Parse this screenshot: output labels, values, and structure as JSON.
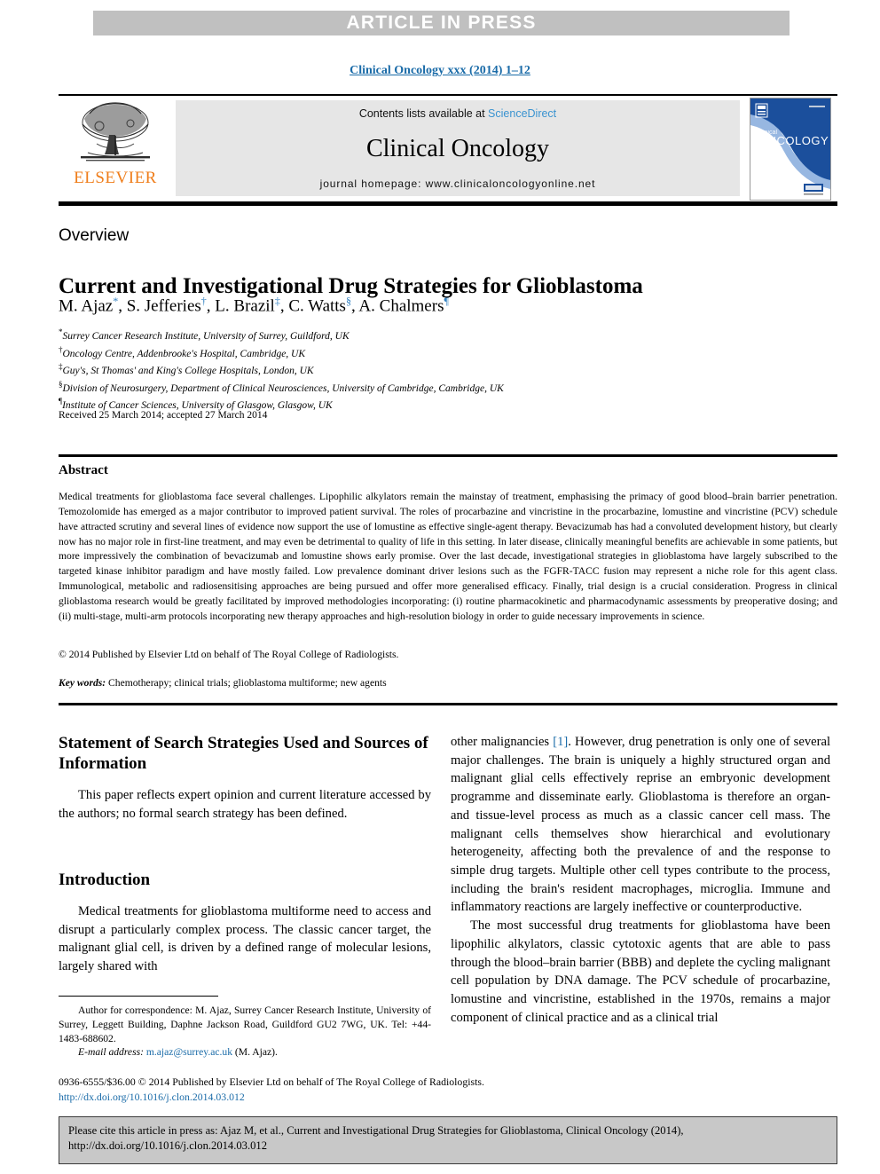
{
  "banner": {
    "text": "ARTICLE IN PRESS"
  },
  "journal_ref": "Clinical Oncology xxx (2014) 1–12",
  "masthead": {
    "publisher_wordmark": "ELSEVIER",
    "contents_prefix": "Contents lists available at ",
    "contents_link": "ScienceDirect",
    "journal_title": "Clinical Oncology",
    "homepage": "journal homepage: www.clinicaloncologyonline.net",
    "cover_line1": "clinical",
    "cover_line2": "ONCOLOGY"
  },
  "article": {
    "type_label": "Overview",
    "title": "Current and Investigational Drug Strategies for Glioblastoma",
    "authors": [
      {
        "name": "M. Ajaz",
        "marker": "*"
      },
      {
        "name": "S. Jefferies",
        "marker": "†"
      },
      {
        "name": "L. Brazil",
        "marker": "‡"
      },
      {
        "name": "C. Watts",
        "marker": "§"
      },
      {
        "name": "A. Chalmers",
        "marker": "¶"
      }
    ],
    "affiliations": [
      {
        "marker": "*",
        "text": "Surrey Cancer Research Institute, University of Surrey, Guildford, UK"
      },
      {
        "marker": "†",
        "text": "Oncology Centre, Addenbrooke's Hospital, Cambridge, UK"
      },
      {
        "marker": "‡",
        "text": "Guy's, St Thomas' and King's College Hospitals, London, UK"
      },
      {
        "marker": "§",
        "text": "Division of Neurosurgery, Department of Clinical Neurosciences, University of Cambridge, Cambridge, UK"
      },
      {
        "marker": "¶",
        "text": "Institute of Cancer Sciences, University of Glasgow, Glasgow, UK"
      }
    ],
    "history": "Received 25 March 2014; accepted 27 March 2014"
  },
  "abstract": {
    "heading": "Abstract",
    "body": "Medical treatments for glioblastoma face several challenges. Lipophilic alkylators remain the mainstay of treatment, emphasising the primacy of good blood–brain barrier penetration. Temozolomide has emerged as a major contributor to improved patient survival. The roles of procarbazine and vincristine in the procarbazine, lomustine and vincristine (PCV) schedule have attracted scrutiny and several lines of evidence now support the use of lomustine as effective single-agent therapy. Bevacizumab has had a convoluted development history, but clearly now has no major role in first-line treatment, and may even be detrimental to quality of life in this setting. In later disease, clinically meaningful benefits are achievable in some patients, but more impressively the combination of bevacizumab and lomustine shows early promise. Over the last decade, investigational strategies in glioblastoma have largely subscribed to the targeted kinase inhibitor paradigm and have mostly failed. Low prevalence dominant driver lesions such as the FGFR-TACC fusion may represent a niche role for this agent class. Immunological, metabolic and radiosensitising approaches are being pursued and offer more generalised efficacy. Finally, trial design is a crucial consideration. Progress in clinical glioblastoma research would be greatly facilitated by improved methodologies incorporating: (i) routine pharmacokinetic and pharmacodynamic assessments by preoperative dosing; and (ii) multi-stage, multi-arm protocols incorporating new therapy approaches and high-resolution biology in order to guide necessary improvements in science.",
    "copyright": "© 2014 Published by Elsevier Ltd on behalf of The Royal College of Radiologists.",
    "keywords_label": "Key words:",
    "keywords_value": " Chemotherapy; clinical trials; glioblastoma multiforme; new agents"
  },
  "sections": {
    "search_heading": "Statement of Search Strategies Used and Sources of Information",
    "search_para": "This paper reflects expert opinion and current literature accessed by the authors; no formal search strategy has been defined.",
    "intro_heading": "Introduction",
    "intro_para_left": "Medical treatments for glioblastoma multiforme need to access and disrupt a particularly complex process. The classic cancer target, the malignant glial cell, is driven by a defined range of molecular lesions, largely shared with",
    "intro_para_right_pre": "other malignancies ",
    "intro_ref": "[1]",
    "intro_para_right_post": ". However, drug penetration is only one of several major challenges. The brain is uniquely a highly structured organ and malignant glial cells effectively reprise an embryonic development programme and disseminate early. Glioblastoma is therefore an organ- and tissue-level process as much as a classic cancer cell mass. The malignant cells themselves show hierarchical and evolutionary heterogeneity, affecting both the prevalence of and the response to simple drug targets. Multiple other cell types contribute to the process, including the brain's resident macrophages, microglia. Immune and inflammatory reactions are largely ineffective or counterproductive.",
    "para_alkylators": "The most successful drug treatments for glioblastoma have been lipophilic alkylators, classic cytotoxic agents that are able to pass through the blood–brain barrier (BBB) and deplete the cycling malignant cell population by DNA damage. The PCV schedule of procarbazine, lomustine and vincristine, established in the 1970s, remains a major component of clinical practice and as a clinical trial"
  },
  "footnote": {
    "correspondence": "Author for correspondence: M. Ajaz, Surrey Cancer Research Institute, University of Surrey, Leggett Building, Daphne Jackson Road, Guildford GU2 7WG, UK. Tel: +44-1483-688602.",
    "email_label": "E-mail address:",
    "email": "m.ajaz@surrey.ac.uk",
    "email_suffix": " (M. Ajaz)."
  },
  "issn": {
    "line": "0936-6555/$36.00 © 2014 Published by Elsevier Ltd on behalf of The Royal College of Radiologists.",
    "doi": "http://dx.doi.org/10.1016/j.clon.2014.03.012"
  },
  "cite_box": {
    "text": "Please cite this article in press as: Ajaz M, et al., Current and Investigational Drug Strategies for Glioblastoma, Clinical Oncology (2014), http://dx.doi.org/10.1016/j.clon.2014.03.012"
  },
  "colors": {
    "link_blue": "#1a6ba8",
    "sciencedirect_blue": "#3a93d0",
    "elsevier_orange": "#ef7d1a",
    "banner_grey": "#c0c0c0",
    "masthead_grey": "#e6e6e6",
    "cite_box_grey": "#c8c8c8",
    "cover_blue": "#1b4f9c"
  }
}
